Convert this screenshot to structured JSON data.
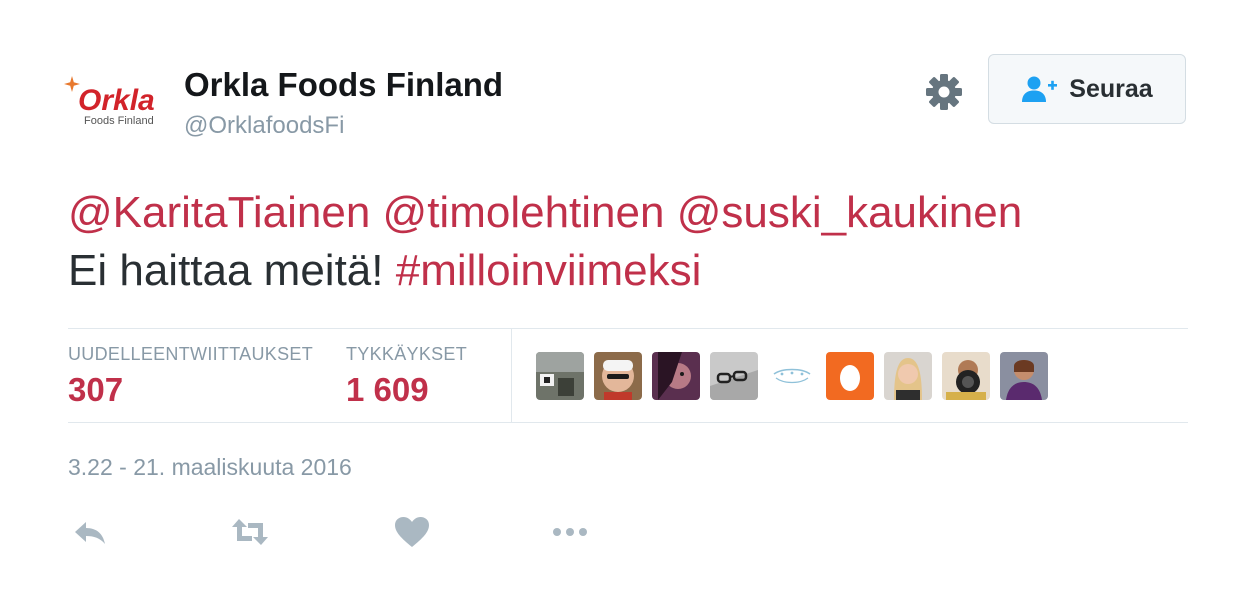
{
  "author": {
    "display_name": "Orkla Foods Finland",
    "handle": "@OrklafoodsFi",
    "avatar": {
      "logo_text": "Orkla",
      "logo_subtext": "Foods Finland",
      "brand_color": "#d2232a"
    }
  },
  "header": {
    "settings_icon": "gear-icon",
    "follow_button": {
      "label": "Seuraa",
      "icon": "user-add-icon"
    }
  },
  "tweet": {
    "mentions": [
      "@KaritaTiainen",
      "@timolehtinen",
      "@suski_kaukinen"
    ],
    "text": "Ei haittaa meitä!",
    "hashtag": "#milloinviimeksi"
  },
  "stats": {
    "retweets_label": "UUDELLEENTWIITTAUKSET",
    "retweets_count": "307",
    "likes_label": "TYKKÄYKSET",
    "likes_count": "1 609"
  },
  "timestamp": "3.22 - 21. maaliskuuta 2016",
  "actions": [
    "reply-icon",
    "retweet-icon",
    "heart-icon",
    "more-icon"
  ],
  "colors": {
    "link": "#c0304a",
    "muted": "#8899a6",
    "action_icon": "#aab8c2"
  }
}
